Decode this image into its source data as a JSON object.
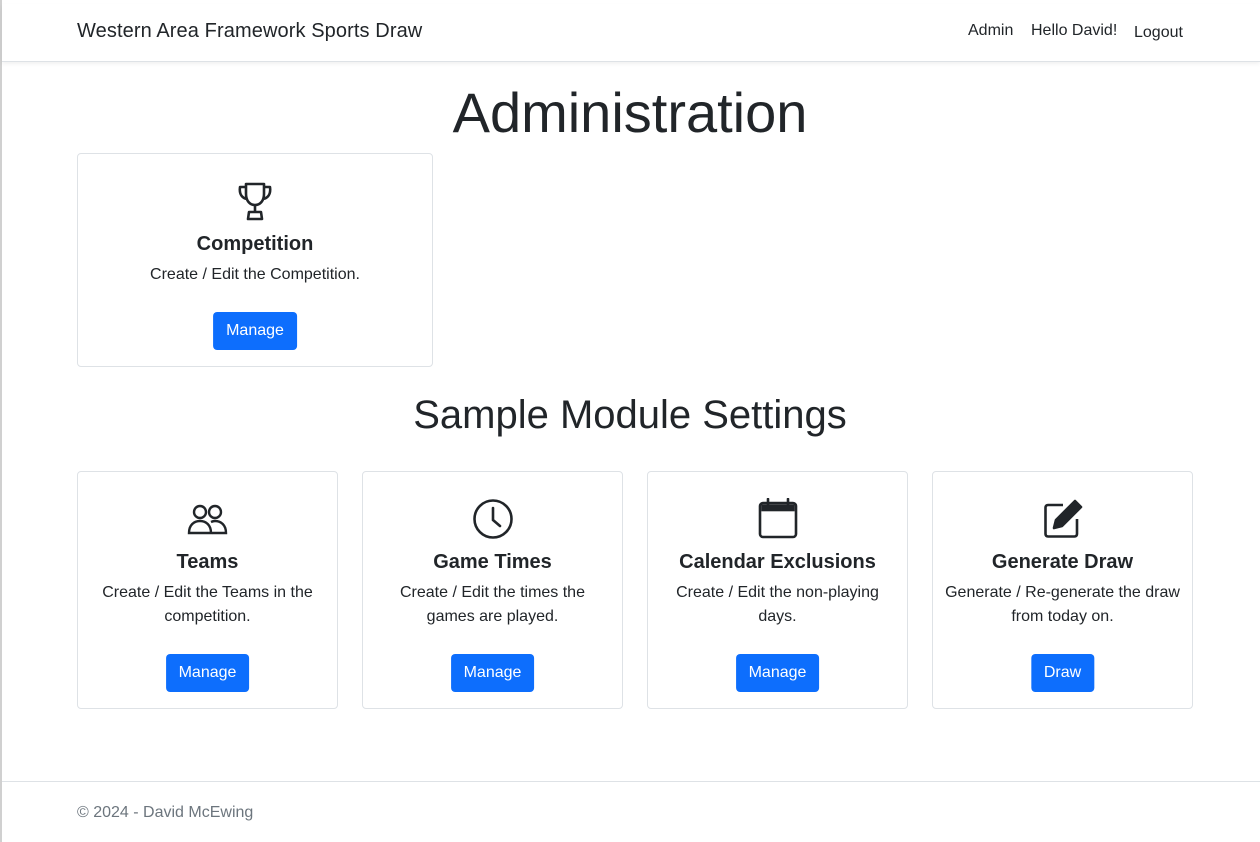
{
  "navbar": {
    "brand": "Western Area Framework Sports Draw",
    "links": [
      "Admin",
      "Hello David!",
      "Logout"
    ]
  },
  "page_title": "Administration",
  "competition_card": {
    "icon": "trophy-icon",
    "title": "Competition",
    "text": "Create / Edit the Competition.",
    "button": "Manage"
  },
  "section_title": "Sample Module Settings",
  "module_cards": [
    {
      "icon": "people-icon",
      "title": "Teams",
      "text": "Create / Edit the Teams in the competition.",
      "button": "Manage"
    },
    {
      "icon": "clock-icon",
      "title": "Game Times",
      "text": "Create / Edit the times the games are played.",
      "button": "Manage"
    },
    {
      "icon": "calendar-icon",
      "title": "Calendar Exclusions",
      "text": "Create / Edit the non-playing days.",
      "button": "Manage"
    },
    {
      "icon": "pencil-square-icon",
      "title": "Generate Draw",
      "text": "Generate / Re-generate the draw from today on.",
      "button": "Draw"
    }
  ],
  "footer": {
    "text": "© 2024 - David McEwing"
  },
  "colors": {
    "primary": "#0d6efd",
    "text": "#212529",
    "muted": "#6c757d",
    "border": "#dee2e6"
  }
}
